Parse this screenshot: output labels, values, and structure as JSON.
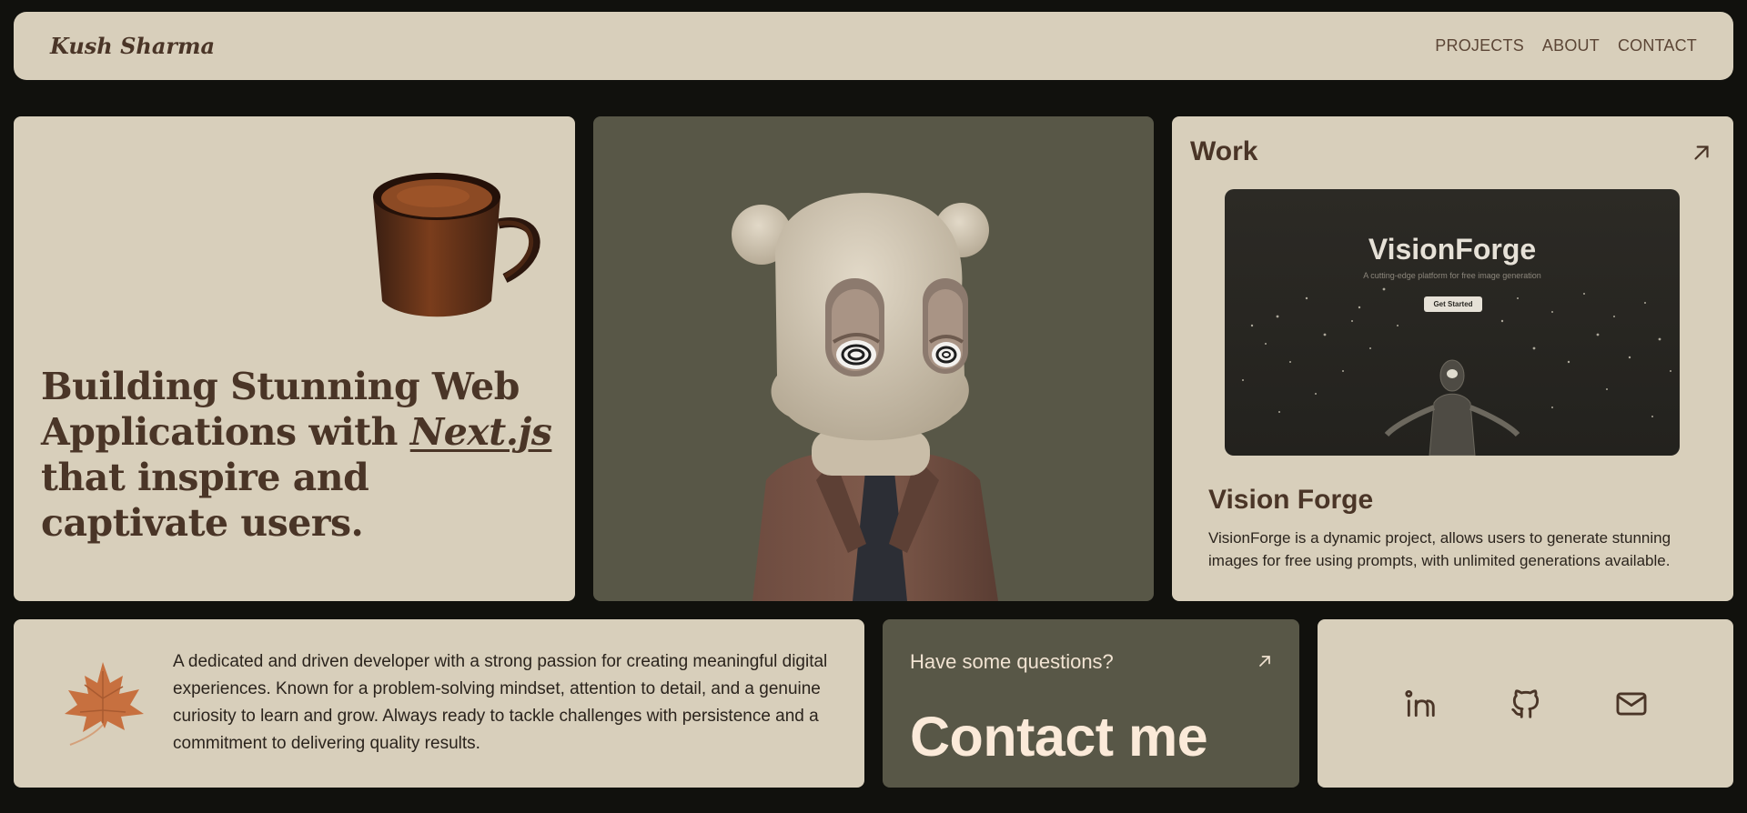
{
  "header": {
    "logo": "Kush Sharma",
    "nav": [
      "PROJECTS",
      "ABOUT",
      "CONTACT"
    ]
  },
  "hero": {
    "headline_part1": "Building Stunning Web Applications with ",
    "headline_emph": "Next.js",
    "headline_part2": " that inspire and captivate users."
  },
  "work": {
    "title": "Work",
    "screenshot": {
      "title": "VisionForge",
      "subtitle": "A cutting-edge platform for free image generation",
      "button": "Get Started"
    },
    "project_name": "Vision Forge",
    "project_desc": "VisionForge is a dynamic project, allows users to generate stunning images for free using prompts, with unlimited generations available."
  },
  "about": {
    "text": "A dedicated and driven developer with a strong passion for creating meaningful digital experiences. Known for a problem-solving mindset, attention to detail, and a genuine curiosity to learn and grow. Always ready to tackle challenges with persistence and a commitment to delivering quality results."
  },
  "contact": {
    "question": "Have some questions?",
    "cta": "Contact me"
  },
  "social": {
    "icons": [
      "linkedin-icon",
      "github-icon",
      "mail-icon"
    ]
  },
  "colors": {
    "page_bg": "#11110d",
    "card_bg": "#d8cfbb",
    "dark_card_bg": "#585747",
    "text_brown": "#4a3527",
    "cta_text": "#fbead9"
  }
}
